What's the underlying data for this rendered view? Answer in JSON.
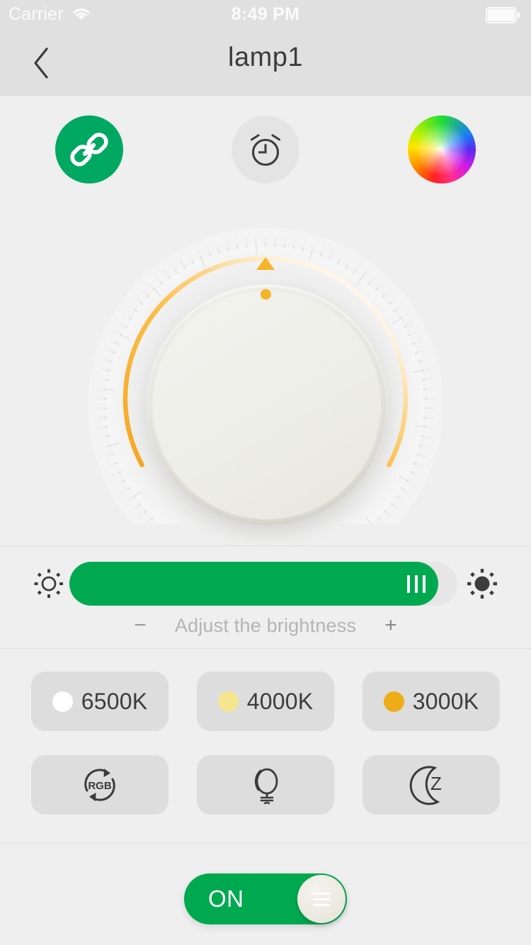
{
  "status_bar": {
    "carrier": "Carrier",
    "time": "8:49 PM",
    "wifi_icon": "wifi-icon",
    "battery_icon": "battery-full-icon"
  },
  "nav": {
    "back_icon": "chevron-left-icon",
    "title": "lamp1"
  },
  "actions": [
    {
      "name": "link-button",
      "icon": "link-icon",
      "active": true,
      "color": "#00a862"
    },
    {
      "name": "timer-button",
      "icon": "alarm-clock-icon",
      "active": false,
      "color": "#e4e4e4"
    },
    {
      "name": "color-wheel-button",
      "icon": "color-wheel-icon",
      "active": false
    }
  ],
  "knob": {
    "name": "brightness-dial",
    "arc_color": "#f5b427",
    "marker_icon": "triangle-up-marker",
    "indicator_dot": "dial-position-dot"
  },
  "brightness": {
    "low_icon": "sun-low-icon",
    "high_icon": "sun-high-icon",
    "value_percent": 95,
    "fill_color": "#00a950",
    "handle_icon": "slider-grip-handle",
    "decrease_label": "−",
    "caption": "Adjust the brightness",
    "increase_label": "+"
  },
  "temperature_presets": [
    {
      "label": "6500K",
      "dot_color": "#ffffff"
    },
    {
      "label": "4000K",
      "dot_color": "#f5e58f"
    },
    {
      "label": "3000K",
      "dot_color": "#eeac17"
    }
  ],
  "mode_presets": [
    {
      "name": "rgb-cycle-button",
      "icon": "rgb-cycle-icon",
      "label": "RGB"
    },
    {
      "name": "bulb-mode-button",
      "icon": "light-bulb-icon",
      "label": ""
    },
    {
      "name": "night-mode-button",
      "icon": "moon-sleep-icon",
      "label": "Z"
    }
  ],
  "power_toggle": {
    "label": "ON",
    "state": "on",
    "track_color": "#00a950",
    "knob_icon": "grip-lines-icon"
  }
}
